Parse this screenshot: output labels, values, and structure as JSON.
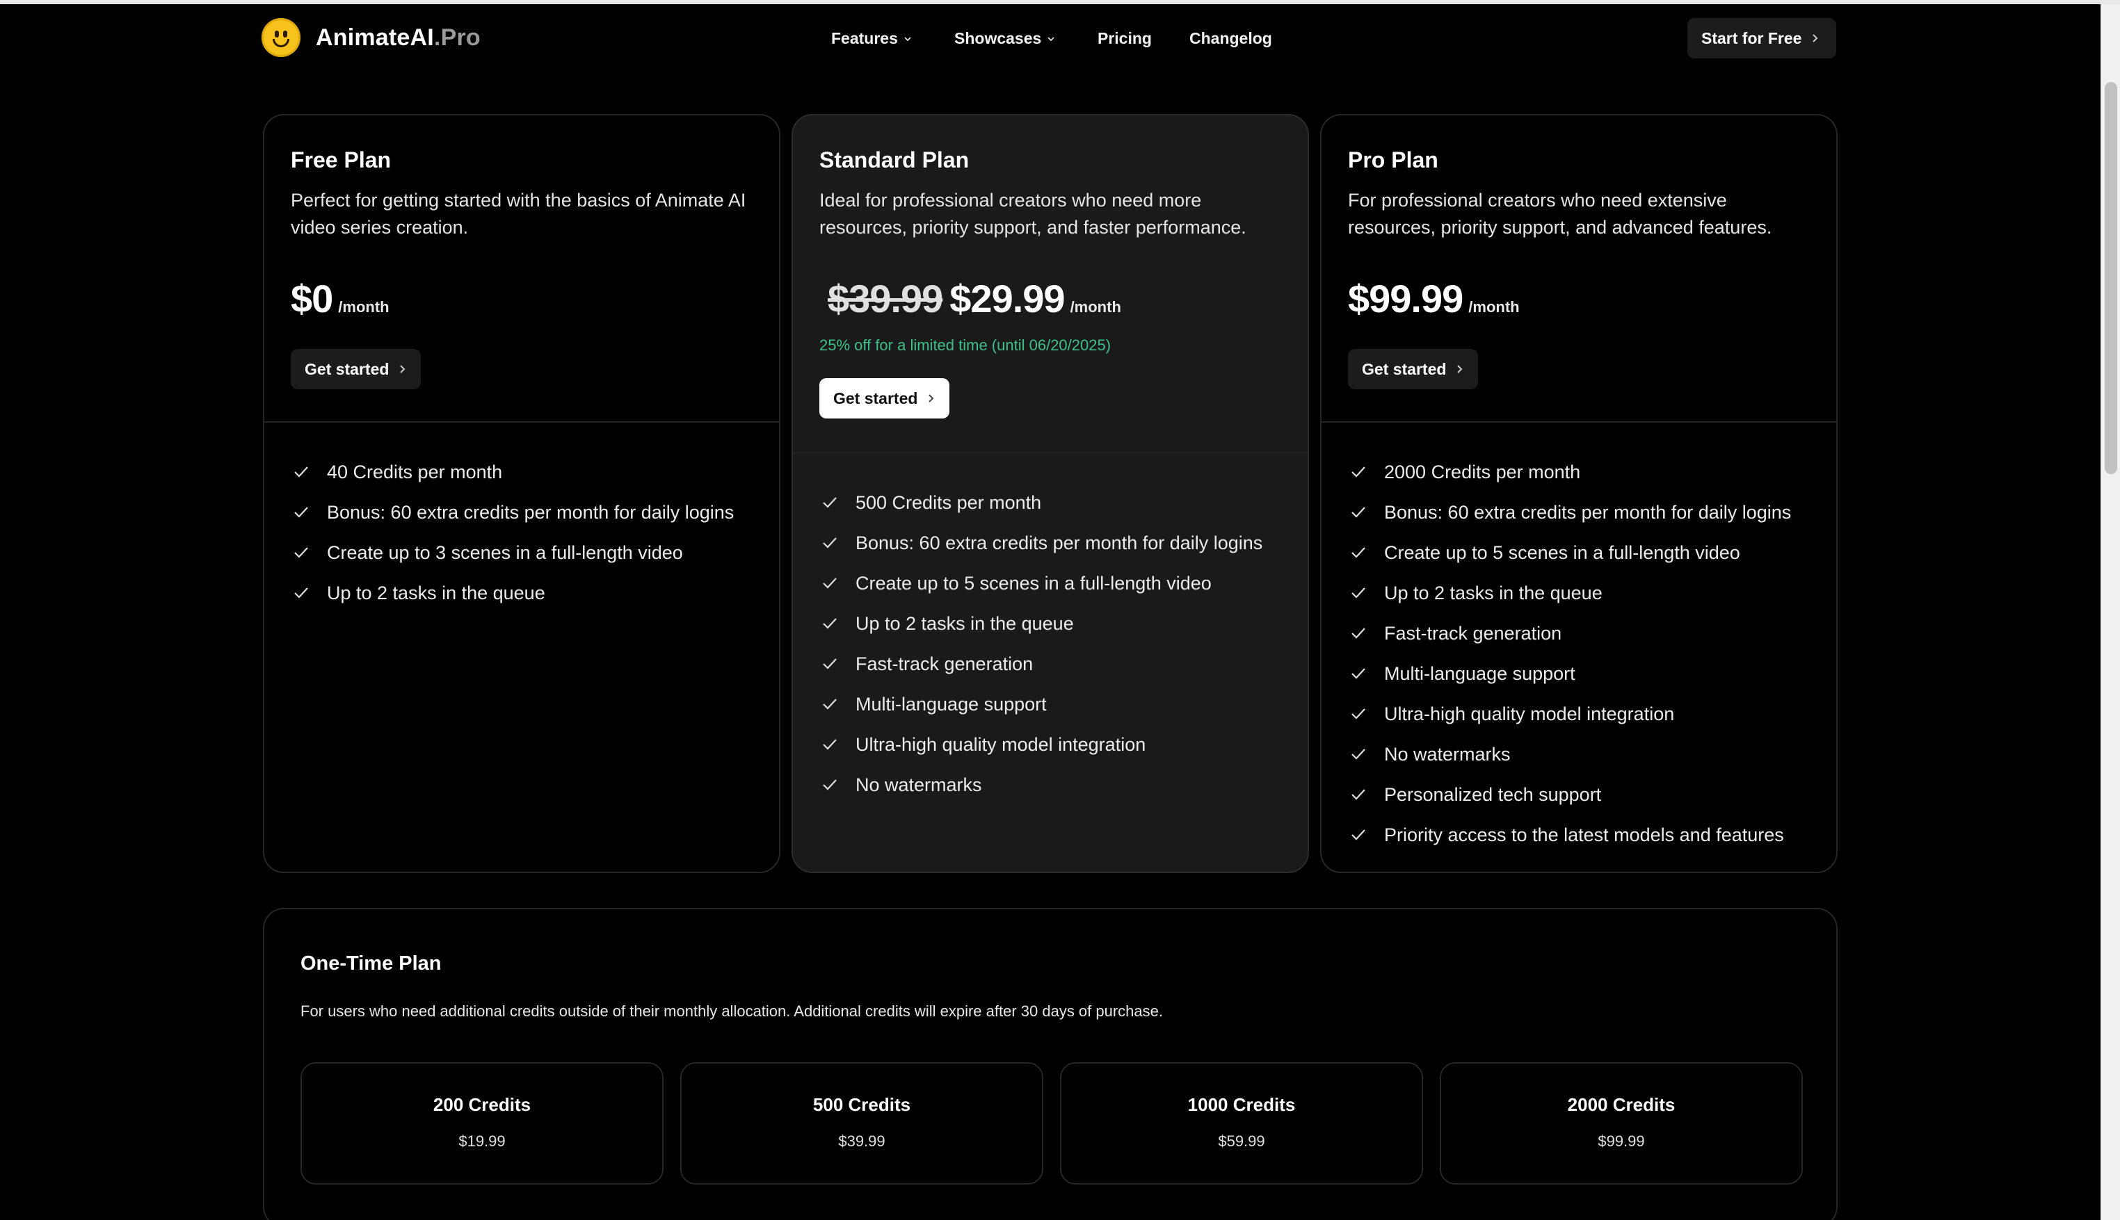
{
  "header": {
    "brand_main": "AnimateAI",
    "brand_suffix": ".Pro",
    "nav": [
      {
        "label": "Features",
        "dropdown": true
      },
      {
        "label": "Showcases",
        "dropdown": true
      },
      {
        "label": "Pricing",
        "dropdown": false
      },
      {
        "label": "Changelog",
        "dropdown": false
      }
    ],
    "cta_label": "Start for Free"
  },
  "plans": [
    {
      "title": "Free Plan",
      "description": "Perfect for getting started with the basics of Animate AI video series creation.",
      "price": "$0",
      "per": "/month",
      "button": "Get started",
      "features": [
        "40 Credits per month",
        "Bonus: 60 extra credits per month for daily logins",
        "Create up to 3 scenes in a full-length video",
        "Up to 2 tasks in the queue"
      ]
    },
    {
      "title": "Standard Plan",
      "description": "Ideal for professional creators who need more resources, priority support, and faster performance.",
      "old_price": "$39.99",
      "price": "$29.99",
      "per": "/month",
      "promo": "25% off for a limited time (until 06/20/2025)",
      "button": "Get started",
      "features": [
        "500 Credits per month",
        "Bonus: 60 extra credits per month for daily logins",
        "Create up to 5 scenes in a full-length video",
        "Up to 2 tasks in the queue",
        "Fast-track generation",
        "Multi-language support",
        "Ultra-high quality model integration",
        "No watermarks"
      ]
    },
    {
      "title": "Pro Plan",
      "description": "For professional creators who need extensive resources, priority support, and advanced features.",
      "price": "$99.99",
      "per": "/month",
      "button": "Get started",
      "features": [
        "2000 Credits per month",
        "Bonus: 60 extra credits per month for daily logins",
        "Create up to 5 scenes in a full-length video",
        "Up to 2 tasks in the queue",
        "Fast-track generation",
        "Multi-language support",
        "Ultra-high quality model integration",
        "No watermarks",
        "Personalized tech support",
        "Priority access to the latest models and features"
      ]
    }
  ],
  "one_time": {
    "title": "One-Time Plan",
    "description": "For users who need additional credits outside of their monthly allocation. Additional credits will expire after 30 days of purchase.",
    "packages": [
      {
        "name": "200 Credits",
        "price": "$19.99"
      },
      {
        "name": "500 Credits",
        "price": "$39.99"
      },
      {
        "name": "1000 Credits",
        "price": "$59.99"
      },
      {
        "name": "2000 Credits",
        "price": "$99.99"
      }
    ]
  },
  "colors": {
    "background": "#000000",
    "featured_card": "#1a1a1a",
    "promo_green": "#3fc08a",
    "logo_yellow": "#f6c21b"
  }
}
